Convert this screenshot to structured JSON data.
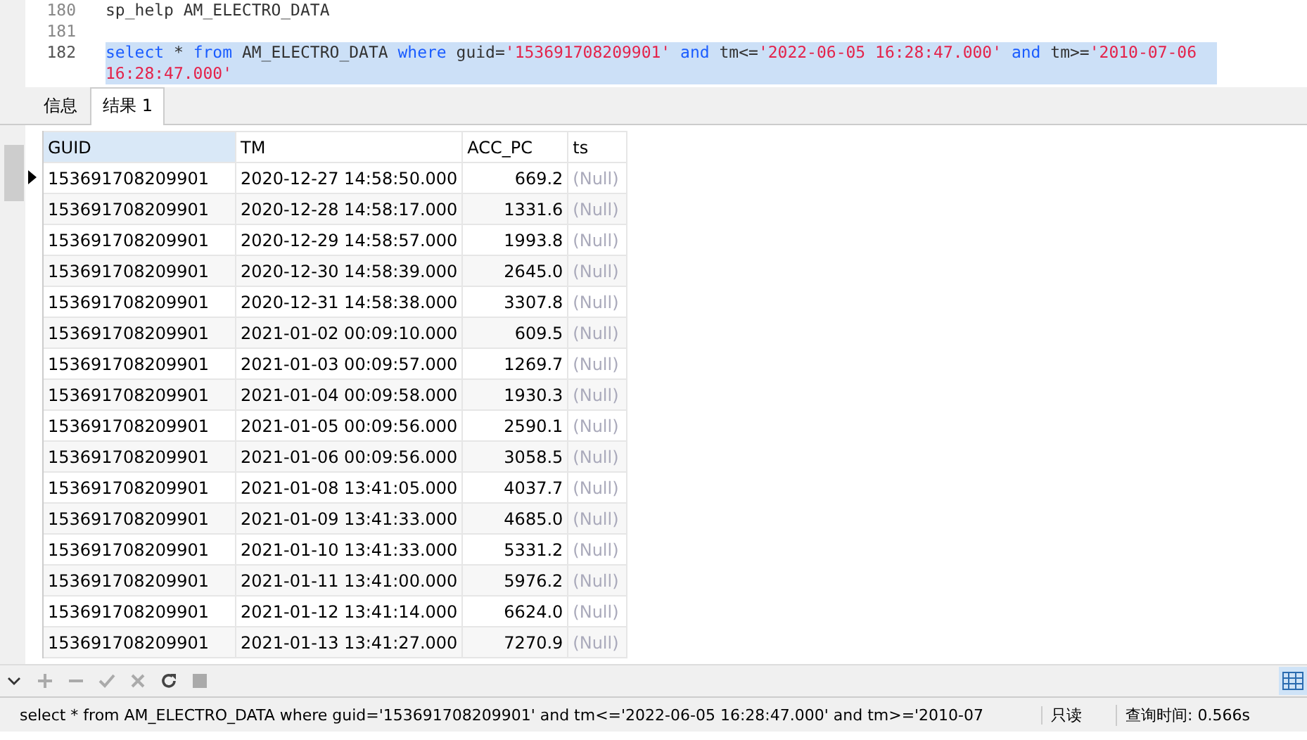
{
  "editor": {
    "lines": [
      {
        "number": "180",
        "selected": false,
        "tokens": [
          {
            "kind": "plain",
            "text": "sp_help AM_ELECTRO_DATA"
          }
        ]
      },
      {
        "number": "181",
        "selected": false
      },
      {
        "number": "182",
        "selected": true,
        "tokens": [
          {
            "kind": "keyword",
            "text": "select"
          },
          {
            "kind": "plain",
            "text": " * "
          },
          {
            "kind": "keyword",
            "text": "from"
          },
          {
            "kind": "plain",
            "text": " AM_ELECTRO_DATA "
          },
          {
            "kind": "keyword",
            "text": "where"
          },
          {
            "kind": "plain",
            "text": " guid="
          },
          {
            "kind": "string",
            "text": "'153691708209901'"
          },
          {
            "kind": "keyword",
            "text": " and"
          },
          {
            "kind": "plain",
            "text": " tm<="
          },
          {
            "kind": "string",
            "text": "'2022-06-05 16:28:47.000'"
          },
          {
            "kind": "keyword",
            "text": " and"
          },
          {
            "kind": "plain",
            "text": " tm>="
          },
          {
            "kind": "string",
            "text": "'2010-07-06 16:28:47.000'"
          }
        ]
      }
    ]
  },
  "tabs": [
    {
      "label": "信息",
      "selected": false
    },
    {
      "label": "结果 1",
      "selected": true
    }
  ],
  "table": {
    "columns": [
      {
        "label": "GUID",
        "selected": true
      },
      {
        "label": "TM",
        "selected": false
      },
      {
        "label": "ACC_PC",
        "selected": false
      },
      {
        "label": "ts",
        "selected": false
      }
    ],
    "rows": [
      {
        "current": true,
        "cells": [
          "153691708209901",
          "2020-12-27 14:58:50.000",
          "669.2",
          "(Null)"
        ]
      },
      {
        "current": false,
        "cells": [
          "153691708209901",
          "2020-12-28 14:58:17.000",
          "1331.6",
          "(Null)"
        ]
      },
      {
        "current": false,
        "cells": [
          "153691708209901",
          "2020-12-29 14:58:57.000",
          "1993.8",
          "(Null)"
        ]
      },
      {
        "current": false,
        "cells": [
          "153691708209901",
          "2020-12-30 14:58:39.000",
          "2645.0",
          "(Null)"
        ]
      },
      {
        "current": false,
        "cells": [
          "153691708209901",
          "2020-12-31 14:58:38.000",
          "3307.8",
          "(Null)"
        ]
      },
      {
        "current": false,
        "cells": [
          "153691708209901",
          "2021-01-02 00:09:10.000",
          "609.5",
          "(Null)"
        ]
      },
      {
        "current": false,
        "cells": [
          "153691708209901",
          "2021-01-03 00:09:57.000",
          "1269.7",
          "(Null)"
        ]
      },
      {
        "current": false,
        "cells": [
          "153691708209901",
          "2021-01-04 00:09:58.000",
          "1930.3",
          "(Null)"
        ]
      },
      {
        "current": false,
        "cells": [
          "153691708209901",
          "2021-01-05 00:09:56.000",
          "2590.1",
          "(Null)"
        ]
      },
      {
        "current": false,
        "cells": [
          "153691708209901",
          "2021-01-06 00:09:56.000",
          "3058.5",
          "(Null)"
        ]
      },
      {
        "current": false,
        "cells": [
          "153691708209901",
          "2021-01-08 13:41:05.000",
          "4037.7",
          "(Null)"
        ]
      },
      {
        "current": false,
        "cells": [
          "153691708209901",
          "2021-01-09 13:41:33.000",
          "4685.0",
          "(Null)"
        ]
      },
      {
        "current": false,
        "cells": [
          "153691708209901",
          "2021-01-10 13:41:33.000",
          "5331.2",
          "(Null)"
        ]
      },
      {
        "current": false,
        "cells": [
          "153691708209901",
          "2021-01-11 13:41:00.000",
          "5976.2",
          "(Null)"
        ]
      },
      {
        "current": false,
        "cells": [
          "153691708209901",
          "2021-01-12 13:41:14.000",
          "6624.0",
          "(Null)"
        ]
      },
      {
        "current": false,
        "cells": [
          "153691708209901",
          "2021-01-13 13:41:27.000",
          "7270.9",
          "(Null)"
        ]
      }
    ]
  },
  "status_bar": {
    "query": "select * from AM_ELECTRO_DATA where guid='153691708209901' and tm<='2022-06-05 16:28:47.000' and tm>='2010-07",
    "mode": "只读",
    "time": "查询时间: 0.566s"
  }
}
